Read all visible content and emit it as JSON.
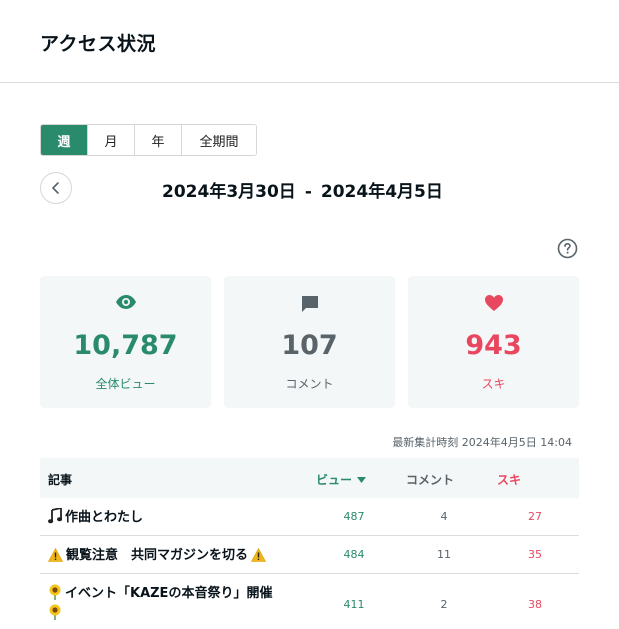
{
  "header": {
    "title": "アクセス状況"
  },
  "period_tabs": [
    {
      "label": "週",
      "active": true
    },
    {
      "label": "月",
      "active": false
    },
    {
      "label": "年",
      "active": false
    },
    {
      "label": "全期間",
      "active": false
    }
  ],
  "date_range": {
    "start": "2024年3月30日",
    "separator": "-",
    "end": "2024年4月5日"
  },
  "summary": {
    "views": {
      "value": "10,787",
      "label": "全体ビュー",
      "icon": "eye-icon",
      "color": "#2a8a6c"
    },
    "comments": {
      "value": "107",
      "label": "コメント",
      "icon": "comment-icon",
      "color": "#58636a"
    },
    "likes": {
      "value": "943",
      "label": "スキ",
      "icon": "heart-icon",
      "color": "#e8475f"
    }
  },
  "updated_at": "最新集計時刻 2024年4月5日 14:04",
  "table": {
    "headers": {
      "title": "記事",
      "views": "ビュー",
      "comments": "コメント",
      "likes": "スキ"
    },
    "rows": [
      {
        "title": "作曲とわたし",
        "views": "487",
        "comments": "4",
        "likes": "27",
        "prefix_icon": "music-note-icon"
      },
      {
        "title": "観覧注意　共同マガジンを切る",
        "views": "484",
        "comments": "11",
        "likes": "35",
        "prefix_icon": "warning-icon",
        "suffix_icon": "warning-icon"
      },
      {
        "title": "イベント「KAZEの本音祭り」開催",
        "views": "411",
        "comments": "2",
        "likes": "38",
        "prefix_icon": "sunflower-icon",
        "suffix_icon": "sunflower-icon"
      }
    ]
  }
}
